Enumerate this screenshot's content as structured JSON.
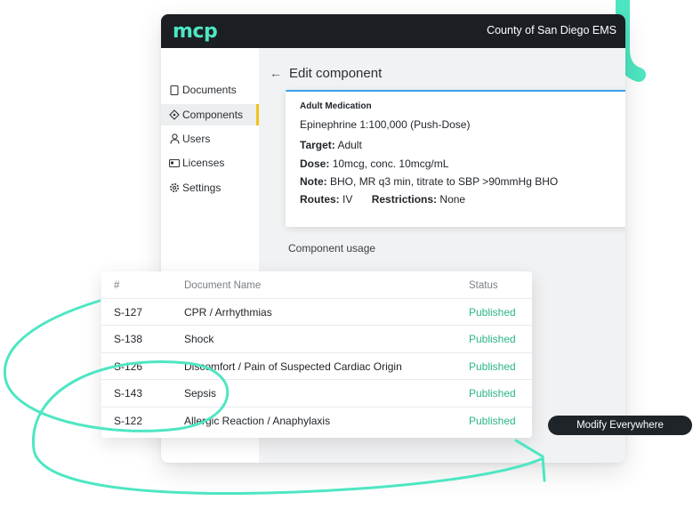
{
  "app": {
    "logo": "mcp",
    "organization": "County of San Diego EMS"
  },
  "sidebar": {
    "items": [
      {
        "label": "Documents",
        "icon": "document-icon"
      },
      {
        "label": "Components",
        "icon": "component-icon",
        "active": true
      },
      {
        "label": "Users",
        "icon": "user-icon"
      },
      {
        "label": "Licenses",
        "icon": "license-icon"
      },
      {
        "label": "Settings",
        "icon": "gear-icon"
      }
    ]
  },
  "page": {
    "title": "Edit component",
    "usage_label": "Component usage"
  },
  "component": {
    "category": "Adult Medication",
    "name": "Epinephrine 1:100,000 (Push-Dose)",
    "target_label": "Target:",
    "target_value": "Adult",
    "dose_label": "Dose:",
    "dose_value": "10mcg, conc. 10mcg/mL",
    "note_label": "Note:",
    "note_value": "BHO, MR q3 min, titrate to SBP >90mmHg BHO",
    "routes_label": "Routes:",
    "routes_value": "IV",
    "restrictions_label": "Restrictions:",
    "restrictions_value": "None"
  },
  "usage_table": {
    "headers": {
      "id": "#",
      "name": "Document Name",
      "status": "Status"
    },
    "rows": [
      {
        "id": "S-127",
        "name": "CPR / Arrhythmias",
        "status": "Published"
      },
      {
        "id": "S-138",
        "name": "Shock",
        "status": "Published"
      },
      {
        "id": "S-126",
        "name": "Discomfort / Pain of Suspected Cardiac Origin",
        "status": "Published"
      },
      {
        "id": "S-143",
        "name": "Sepsis",
        "status": "Published"
      },
      {
        "id": "S-122",
        "name": "Allergic Reaction / Anaphylaxis",
        "status": "Published"
      }
    ]
  },
  "actions": {
    "modify_everywhere": "Modify Everywhere"
  },
  "colors": {
    "accent": "#4ee6c2",
    "status_published": "#2ab58a",
    "active_indicator": "#f0c419",
    "card_top": "#3aa0e6"
  }
}
